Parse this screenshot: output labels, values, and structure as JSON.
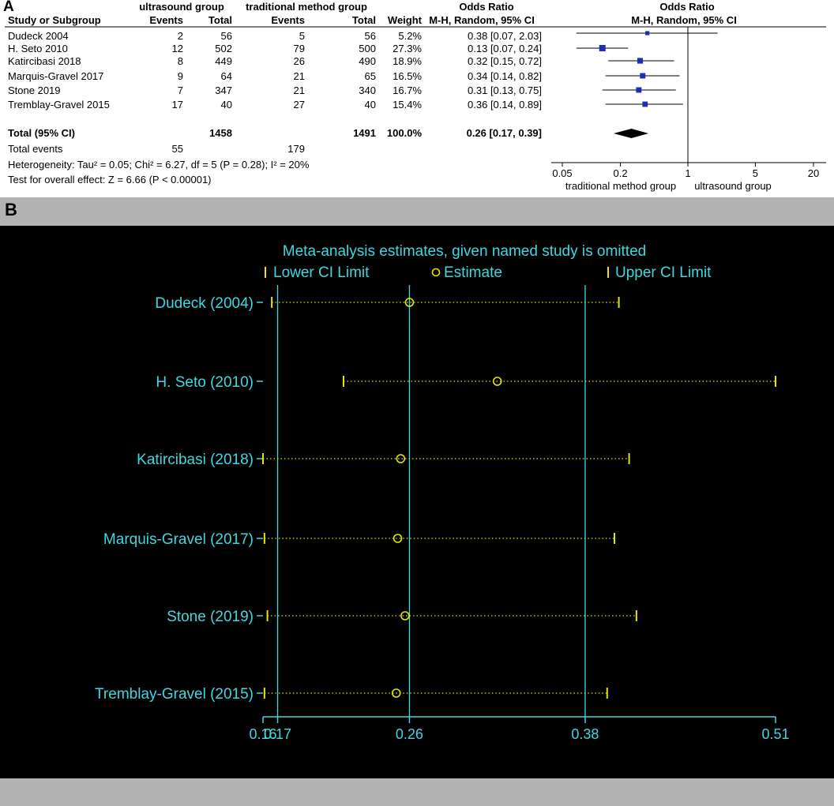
{
  "panel_a": {
    "letter": "A",
    "group_headers": {
      "experimental": "ultrasound group",
      "control": "traditional method group",
      "or_left": "Odds Ratio",
      "or_right": "Odds Ratio"
    },
    "col_headers": {
      "study": "Study or Subgroup",
      "events1": "Events",
      "total1": "Total",
      "events2": "Events",
      "total2": "Total",
      "weight": "Weight",
      "method_left": "M-H, Random, 95% CI",
      "method_right": "M-H, Random, 95% CI"
    },
    "studies": [
      {
        "name": "Dudeck 2004",
        "events1": "2",
        "total1": "56",
        "events2": "5",
        "total2": "56",
        "weight": "5.2%",
        "ci_text": "0.38 [0.07, 2.03]"
      },
      {
        "name": "H. Seto 2010",
        "events1": "12",
        "total1": "502",
        "events2": "79",
        "total2": "500",
        "weight": "27.3%",
        "ci_text": "0.13 [0.07, 0.24]"
      },
      {
        "name": "Katircibasi 2018",
        "events1": "8",
        "total1": "449",
        "events2": "26",
        "total2": "490",
        "weight": "18.9%",
        "ci_text": "0.32 [0.15, 0.72]"
      },
      {
        "name": "Marquis-Gravel 2017",
        "events1": "9",
        "total1": "64",
        "events2": "21",
        "total2": "65",
        "weight": "16.5%",
        "ci_text": "0.34 [0.14, 0.82]"
      },
      {
        "name": "Stone 2019",
        "events1": "7",
        "total1": "347",
        "events2": "21",
        "total2": "340",
        "weight": "16.7%",
        "ci_text": "0.31 [0.13, 0.75]"
      },
      {
        "name": "Tremblay-Gravel 2015",
        "events1": "17",
        "total1": "40",
        "events2": "27",
        "total2": "40",
        "weight": "15.4%",
        "ci_text": "0.36 [0.14, 0.89]"
      }
    ],
    "total": {
      "label": "Total (95% CI)",
      "total1": "1458",
      "total2": "1491",
      "weight": "100.0%",
      "ci_text": "0.26 [0.17, 0.39]"
    },
    "total_events": {
      "label": "Total events",
      "events1": "55",
      "events2": "179"
    },
    "heterogeneity": "Heterogeneity: Tau² = 0.05; Chi² = 6.27, df = 5 (P = 0.28); I² = 20%",
    "overall_effect": "Test for overall effect: Z = 6.66 (P < 0.00001)",
    "axis_label_left": "traditional method group",
    "axis_label_right": "ultrasound group"
  },
  "panel_b": {
    "letter": "B",
    "title": "Meta-analysis estimates, given named study is omitted",
    "legend": {
      "lower": "Lower CI Limit",
      "estimate": "Estimate",
      "upper": "Upper CI Limit"
    }
  },
  "chart_data": [
    {
      "type": "forest",
      "scale": "log",
      "xlim": [
        0.05,
        20
      ],
      "x_ticks": [
        0.05,
        0.2,
        1,
        5,
        20
      ],
      "x_tick_labels": [
        "0.05",
        "0.2",
        "1",
        "5",
        "20"
      ],
      "reference_line": 1,
      "studies": [
        {
          "name": "Dudeck 2004",
          "or": 0.38,
          "lower": 0.07,
          "upper": 2.03,
          "weight": 5.2
        },
        {
          "name": "H. Seto 2010",
          "or": 0.13,
          "lower": 0.07,
          "upper": 0.24,
          "weight": 27.3
        },
        {
          "name": "Katircibasi 2018",
          "or": 0.32,
          "lower": 0.15,
          "upper": 0.72,
          "weight": 18.9
        },
        {
          "name": "Marquis-Gravel 2017",
          "or": 0.34,
          "lower": 0.14,
          "upper": 0.82,
          "weight": 16.5
        },
        {
          "name": "Stone 2019",
          "or": 0.31,
          "lower": 0.13,
          "upper": 0.75,
          "weight": 16.7
        },
        {
          "name": "Tremblay-Gravel 2015",
          "or": 0.36,
          "lower": 0.14,
          "upper": 0.89,
          "weight": 15.4
        }
      ],
      "pooled": {
        "or": 0.26,
        "lower": 0.17,
        "upper": 0.39
      }
    },
    {
      "type": "sensitivity",
      "x_ticks": [
        0.16,
        0.17,
        0.26,
        0.38,
        0.51
      ],
      "x_tick_labels": [
        "0.16",
        "0.17",
        "0.26",
        "0.38",
        "0.51"
      ],
      "xlim": [
        0.16,
        0.51
      ],
      "reference_lines": [
        0.17,
        0.26,
        0.38
      ],
      "rows": [
        {
          "name": "Dudeck (2004)",
          "lower": 0.166,
          "estimate": 0.26,
          "upper": 0.403
        },
        {
          "name": "H. Seto (2010)",
          "lower": 0.215,
          "estimate": 0.32,
          "upper": 0.51
        },
        {
          "name": "Katircibasi (2018)",
          "lower": 0.16,
          "estimate": 0.254,
          "upper": 0.41
        },
        {
          "name": "Marquis-Gravel (2017)",
          "lower": 0.161,
          "estimate": 0.252,
          "upper": 0.4
        },
        {
          "name": "Stone (2019)",
          "lower": 0.163,
          "estimate": 0.257,
          "upper": 0.415
        },
        {
          "name": "Tremblay-Gravel (2015)",
          "lower": 0.161,
          "estimate": 0.251,
          "upper": 0.395
        }
      ],
      "colors": {
        "background": "#000000",
        "axis": "#3fd8e0",
        "text": "#3fd8e0",
        "marks": "#e6e600"
      }
    }
  ]
}
